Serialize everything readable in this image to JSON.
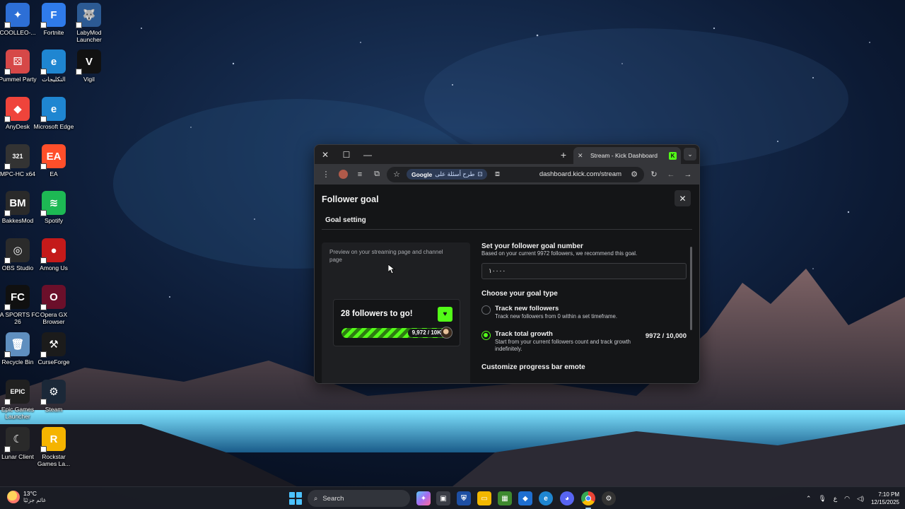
{
  "desktop_icons": [
    {
      "label": "COOLLEO-...",
      "icon": "coolleo-icon",
      "color": "#2d6fd6",
      "glyph": "✦"
    },
    {
      "label": "Fortnite",
      "icon": "fortnite-icon",
      "color": "#2f7bea",
      "glyph": "F"
    },
    {
      "label": "LabyMod Launcher",
      "icon": "labymod-wolf-icon",
      "color": "#2c5a93",
      "glyph": "🐺"
    },
    {
      "label": "Pummel Party",
      "icon": "pummel-party-icon",
      "color": "#d64848",
      "glyph": "⚄"
    },
    {
      "label": "التكليجات",
      "icon": "edge-icon",
      "color": "#1f86d1",
      "glyph": "e"
    },
    {
      "label": "Vigil",
      "icon": "vigil-icon",
      "color": "#111111",
      "glyph": "V"
    },
    {
      "label": "AnyDesk",
      "icon": "anydesk-icon",
      "color": "#ef443b",
      "glyph": "◆"
    },
    {
      "label": "Microsoft Edge",
      "icon": "edge-icon",
      "color": "#1f86d1",
      "glyph": "e"
    },
    {
      "label": "MPC-HC x64",
      "icon": "mpc-hc-icon",
      "color": "#333333",
      "glyph": "321"
    },
    {
      "label": "EA",
      "icon": "ea-icon",
      "color": "#ff4f2a",
      "glyph": "EA"
    },
    {
      "label": "BakkesMod",
      "icon": "bakkesmod-icon",
      "color": "#2a2a2a",
      "glyph": "BM"
    },
    {
      "label": "Spotify",
      "icon": "spotify-icon",
      "color": "#1db954",
      "glyph": "≋"
    },
    {
      "label": "OBS Studio",
      "icon": "obs-icon",
      "color": "#2b2b2b",
      "glyph": "◎"
    },
    {
      "label": "Among Us",
      "icon": "among-us-icon",
      "color": "#c41a1a",
      "glyph": "●"
    },
    {
      "label": "EA SPORTS FC 26",
      "icon": "ea-fc-icon",
      "color": "#101010",
      "glyph": "FC"
    },
    {
      "label": "Opera GX Browser",
      "icon": "opera-gx-icon",
      "color": "#6b0f2a",
      "glyph": "O"
    },
    {
      "label": "Recycle Bin",
      "icon": "recycle-bin-icon",
      "color": "#5f8fbf",
      "glyph": "🗑"
    },
    {
      "label": "CurseForge",
      "icon": "curseforge-icon",
      "color": "#1b1b1b",
      "glyph": "⚒"
    },
    {
      "label": "Epic Games Launcher",
      "icon": "epic-games-icon",
      "color": "#202020",
      "glyph": "EPIC"
    },
    {
      "label": "Steam",
      "icon": "steam-icon",
      "color": "#1b2838",
      "glyph": "⚙"
    },
    {
      "label": "Lunar Client",
      "icon": "lunar-client-icon",
      "color": "#2a2a2a",
      "glyph": "☾"
    },
    {
      "label": "Rockstar Games La...",
      "icon": "rockstar-icon",
      "color": "#f5b400",
      "glyph": "R"
    }
  ],
  "browser": {
    "tab_title": "Stream - Kick Dashboard",
    "url": "dashboard.kick.com/stream",
    "google_chip_brand": "Google",
    "google_chip_text": "طرح أسئلة على"
  },
  "modal": {
    "title": "Follower goal",
    "tab": "Goal setting",
    "preview_text": "Preview on your streaming page and channel page",
    "goal_card_text": "28 followers to go!",
    "progress_label": "9,972 / 10K",
    "progress_fraction": 0.9972,
    "set_goal_title": "Set your follower goal number",
    "set_goal_sub": "Based on your current 9972 followers, we recommend this goal.",
    "goal_input_value": "١٠٠٠٠",
    "goal_type_title": "Choose your goal type",
    "option_new_label": "Track new followers",
    "option_new_desc": "Track new followers from 0 within a set timeframe.",
    "option_total_label": "Track total growth",
    "option_total_desc": "Start from your current followers count and track growth indefinitely.",
    "option_total_count": "9972 / 10,000",
    "emote_title": "Customize progress bar emote"
  },
  "taskbar": {
    "temperature": "13°C",
    "weather_text": "غائم جزئيًا",
    "search_placeholder": "Search",
    "language": "ع",
    "time": "7:10 PM",
    "date": "12/15/2025"
  },
  "colors": {
    "kick_green": "#53fc18",
    "page_bg": "#141517"
  }
}
